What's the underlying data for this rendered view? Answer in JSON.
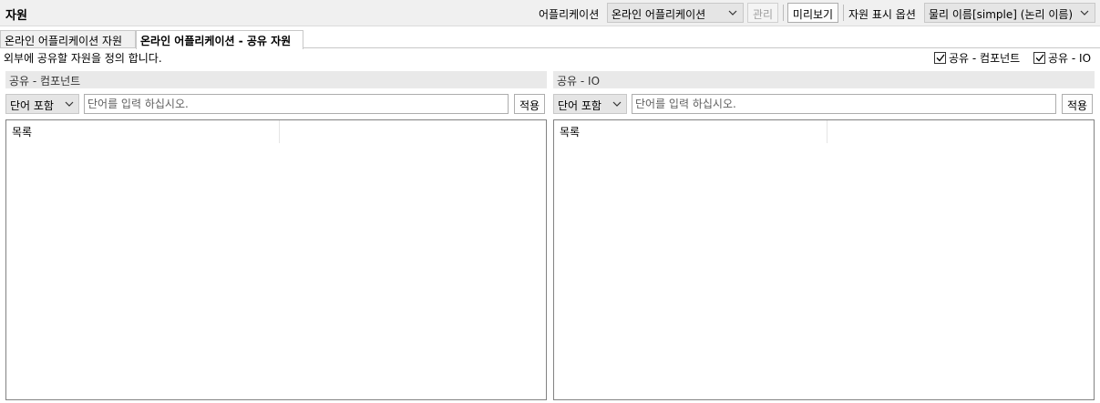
{
  "header": {
    "title": "자원",
    "app_label": "어플리케이션",
    "app_selected": "온라인 어플리케이션",
    "manage_label": "관리",
    "preview_label": "미리보기",
    "display_option_label": "자원 표시 옵션",
    "display_option_selected": "물리 이름[simple] (논리 이름)"
  },
  "tabs": [
    {
      "label": "온라인 어플리케이션 자원",
      "active": false
    },
    {
      "label": "온라인 어플리케이션 - 공유 자원",
      "active": true
    }
  ],
  "description": "외부에 공유할 자원을 정의 합니다.",
  "filters": [
    {
      "label": "공유 - 컴포넌트",
      "checked": true
    },
    {
      "label": "공유 - IO",
      "checked": true
    }
  ],
  "panels": [
    {
      "title": "공유 - 컴포넌트",
      "match_mode": "단어 포함",
      "search_placeholder": "단어를 입력 하십시오.",
      "apply_label": "적용",
      "column_header": "목록"
    },
    {
      "title": "공유 - IO",
      "match_mode": "단어 포함",
      "search_placeholder": "단어를 입력 하십시오.",
      "apply_label": "적용",
      "column_header": "목록"
    }
  ]
}
